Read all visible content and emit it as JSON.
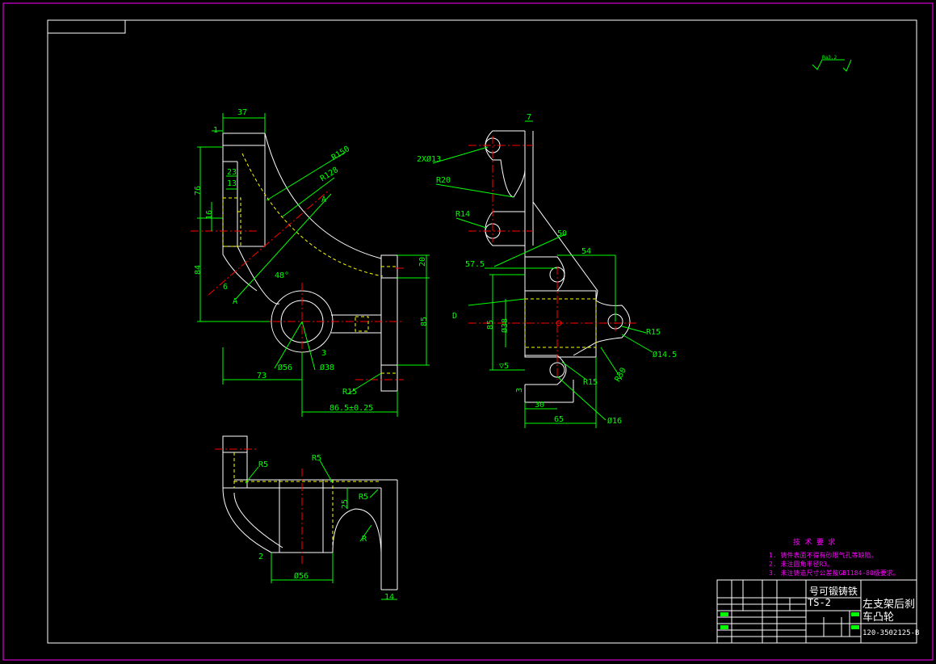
{
  "front_view": {
    "dims": [
      "37",
      "1",
      "23",
      "13",
      "76",
      "16",
      "84",
      "6",
      "48°",
      "73",
      "Ø56",
      "Ø38",
      "3",
      "R15",
      "86.5±0.25",
      "85",
      "20",
      "R150",
      "R128",
      "A",
      "A"
    ]
  },
  "right_view": {
    "dims": [
      "7",
      "2XØ13",
      "R20",
      "R14",
      "50",
      "54",
      "57.5",
      "D",
      "85",
      "Ø38",
      "R15",
      "Ø14.5",
      "▽5",
      "3",
      "R15",
      "R30",
      "30",
      "65",
      "Ø16"
    ]
  },
  "bottom_view": {
    "dims": [
      "R5",
      "R5",
      "R5",
      "25",
      "R",
      "2",
      "Ø56",
      "14"
    ]
  },
  "roughness_symbol": "Ra3.2",
  "tech_requirements": {
    "title": "技 术 要 求",
    "items": [
      "1. 铸件表面不得有砂眼气孔等缺陷。",
      "2. 未注圆角半径R3。",
      "3. 未注铸造尺寸公差按GB1184-80级要求。"
    ]
  },
  "title_block": {
    "material": "号可锻铸铁",
    "material_code": "TS-2",
    "part_name_line1": "左支架后刹",
    "part_name_line2": "车凸轮",
    "drawing_number": "120-3502125-B"
  }
}
